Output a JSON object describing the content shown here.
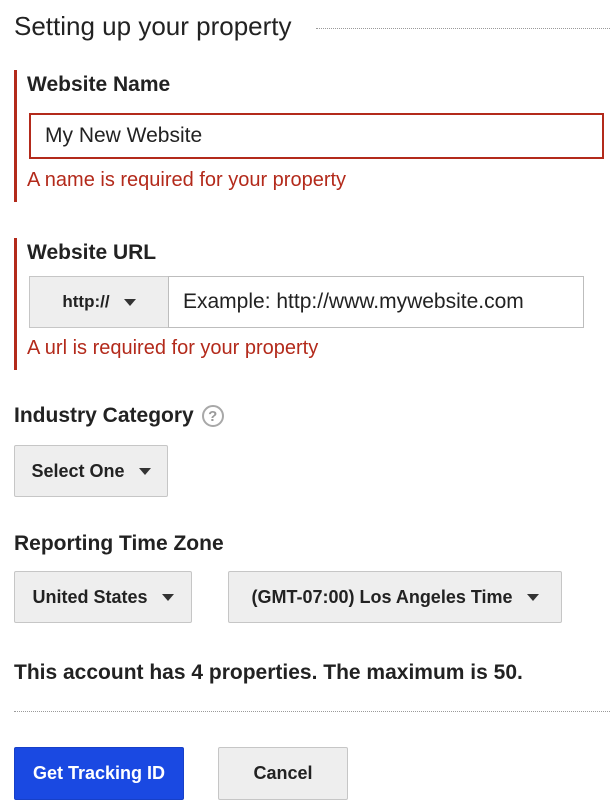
{
  "header": {
    "title": "Setting up your property"
  },
  "website_name": {
    "label": "Website Name",
    "value": "My New Website",
    "error": "A name is required for your property"
  },
  "website_url": {
    "label": "Website URL",
    "protocol": "http://",
    "placeholder": "Example: http://www.mywebsite.com",
    "error": "A url is required for your property"
  },
  "industry": {
    "label": "Industry Category",
    "help_icon": "?",
    "selected": "Select One"
  },
  "timezone": {
    "label": "Reporting Time Zone",
    "country": "United States",
    "zone": "(GMT-07:00) Los Angeles Time"
  },
  "account_info": "This account has 4 properties. The maximum is 50.",
  "actions": {
    "primary_label": "Get Tracking ID",
    "cancel_label": "Cancel"
  },
  "colors": {
    "error": "#b32a1b",
    "primary_button": "#1a49e2",
    "neutral_button": "#eeeeee"
  }
}
